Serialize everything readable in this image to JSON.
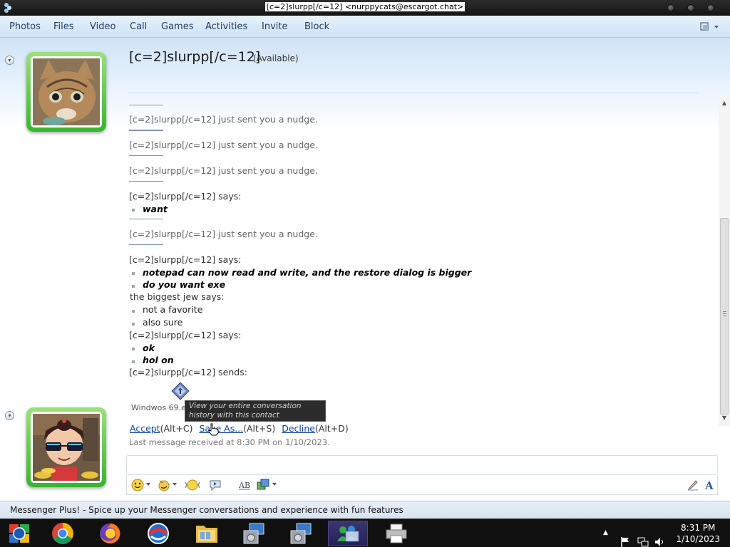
{
  "window": {
    "title": "[c=2]slurpp[/c=12] <nurppycats@escargot.chat>"
  },
  "menu": {
    "items": [
      "Photos",
      "Files",
      "Video",
      "Call",
      "Games",
      "Activities",
      "Invite",
      "Block"
    ]
  },
  "contact": {
    "name": "[c=2]slurpp[/c=12]",
    "status": "(Available)"
  },
  "history": {
    "nudge_text": "[c=2]slurpp[/c=12] just sent you a nudge.",
    "says_label": "[c=2]slurpp[/c=12] says:",
    "other_says_label": "the biggest jew says:",
    "sends_label": "[c=2]slurpp[/c=12] sends:",
    "msg_want": "want",
    "msg_notepad": "notepad can now read and write, and the restore dialog is bigger",
    "msg_exe": "do you want exe",
    "msg_favorite": "not a favorite",
    "msg_sure": "also sure",
    "msg_ok": "ok",
    "msg_holon": "hol on"
  },
  "transfer": {
    "file_name": "Windwos 69.e",
    "tooltip": "View your entire conversation history with this contact",
    "accept": "Accept",
    "accept_key": "(Alt+C)",
    "save_as": "Save As...",
    "save_key": "(Alt+S)",
    "decline": "Decline",
    "decline_key": "(Alt+D)",
    "last_message": "Last message received at 8:30 PM on 1/10/2023."
  },
  "plus_bar": {
    "text": "Messenger Plus! - Spice up your Messenger conversations and experience with fun features"
  },
  "taskbar": {
    "apps": [
      "windows-live-icon",
      "chrome-icon",
      "firefox-icon",
      "opera-icon",
      "file-explorer-icon",
      "installer-icon",
      "installer-icon-2",
      "messenger-icon",
      "printer-icon"
    ],
    "time": "8:31 PM",
    "date": "1/10/2023"
  }
}
